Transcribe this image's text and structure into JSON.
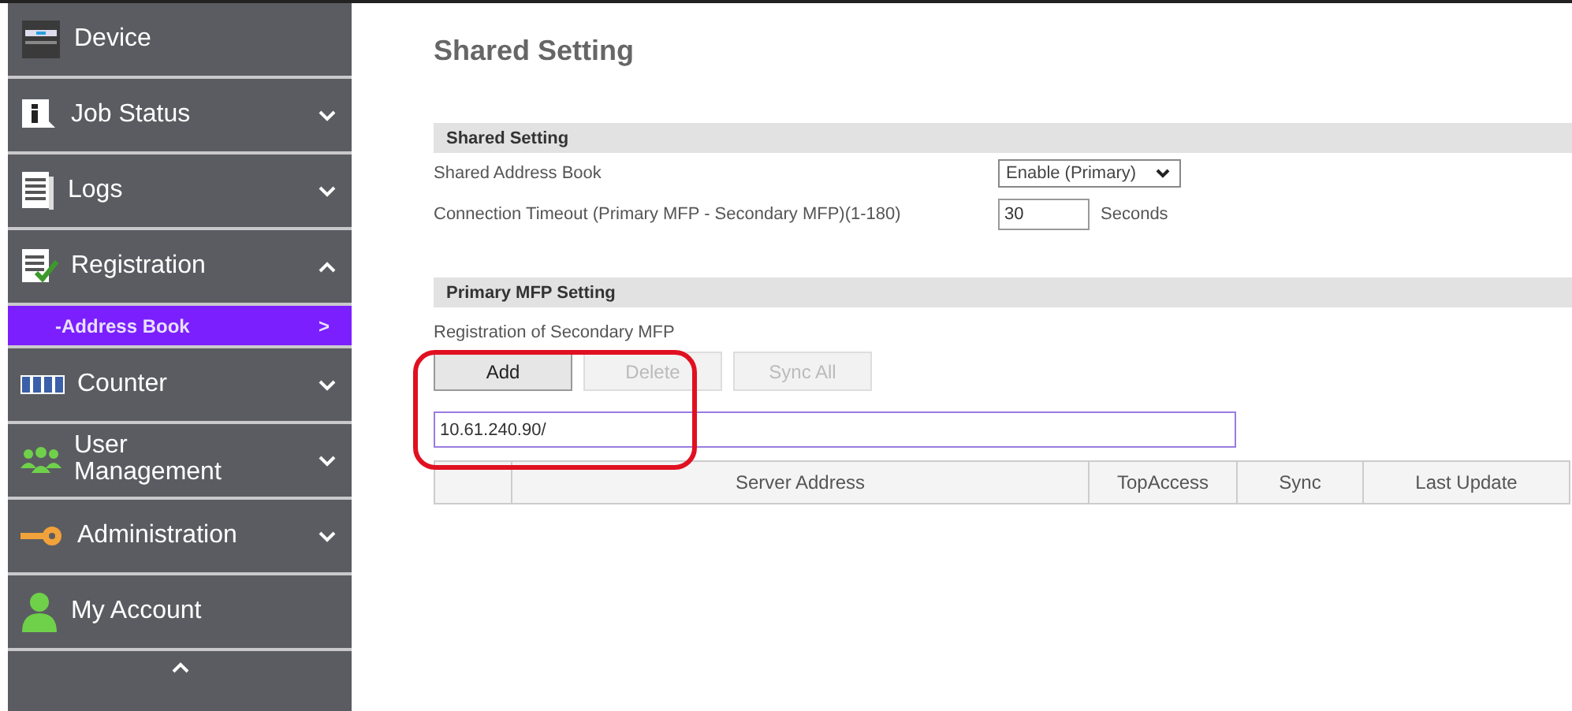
{
  "sidebar": {
    "items": [
      {
        "label": "Device"
      },
      {
        "label": "Job Status",
        "expanded": false
      },
      {
        "label": "Logs",
        "expanded": false
      },
      {
        "label": "Registration",
        "expanded": true,
        "children": [
          {
            "label": "-Address Book",
            "arrow": ">",
            "selected": true
          }
        ]
      },
      {
        "label": "Counter",
        "expanded": false
      },
      {
        "label": "User Management",
        "expanded": false
      },
      {
        "label": "Administration",
        "expanded": false
      },
      {
        "label": "My Account"
      }
    ]
  },
  "page_title": "Shared Setting",
  "sections": [
    {
      "title": "Shared Setting",
      "rows": [
        {
          "kind": "select",
          "label": "Shared Address Book",
          "value": "Enable (Primary)"
        },
        {
          "kind": "number",
          "label": "Connection Timeout (Primary MFP - Secondary MFP)(1-180)",
          "value": "30",
          "unit": "Seconds"
        }
      ]
    },
    {
      "title": "Primary MFP Setting"
    }
  ],
  "registration": {
    "label": "Registration of Secondary MFP",
    "buttons": [
      {
        "label": "Add",
        "disabled": false
      },
      {
        "label": "Delete",
        "disabled": true
      },
      {
        "label": "Sync All",
        "disabled": true
      }
    ],
    "address_input": "10.61.240.90/",
    "table": {
      "columns": [
        "",
        "Server Address",
        "TopAccess",
        "Sync",
        "Last Update"
      ]
    }
  },
  "highlight": true
}
